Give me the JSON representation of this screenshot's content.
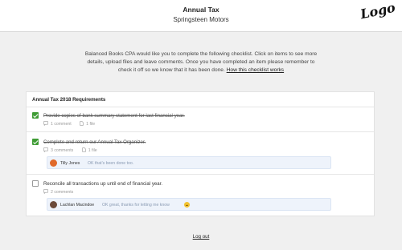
{
  "header": {
    "title": "Annual Tax",
    "subtitle": "Springsteen Motors",
    "logo_text": "Logo"
  },
  "intro": {
    "text": "Balanced Books CPA would like you to complete the following checklist. Click on items to see more details, upload files and leave comments. Once you have completed an item please remember to check it off so we know that it has been done.",
    "link_label": "How this checklist works"
  },
  "checklist": {
    "title": "Annual Tax 2018 Requirements",
    "items": [
      {
        "label": "Provide copies of bank summary statement for last financial year.",
        "checked": true,
        "comments": "1 comment",
        "files": "1 file"
      },
      {
        "label": "Complete and return our Annual Tax Organizer.",
        "checked": true,
        "comments": "3 comments",
        "files": "1 file",
        "latest_comment": {
          "author": "Tilly Jones",
          "text": "OK that's been done too.",
          "avatar_color": "#e06a2b"
        }
      },
      {
        "label": "Reconcile all transactions up until end of financial year.",
        "checked": false,
        "comments": "2 comments",
        "latest_comment": {
          "author": "Lachlan Macindoe",
          "text": "OK great, thanks for letting me know",
          "avatar_color": "#6b4a3a",
          "emoji": "smiling-face"
        }
      }
    ]
  },
  "footer": {
    "logout_label": "Log out"
  },
  "colors": {
    "check_green": "#3f9c35",
    "comment_bg": "#eef3fb"
  }
}
